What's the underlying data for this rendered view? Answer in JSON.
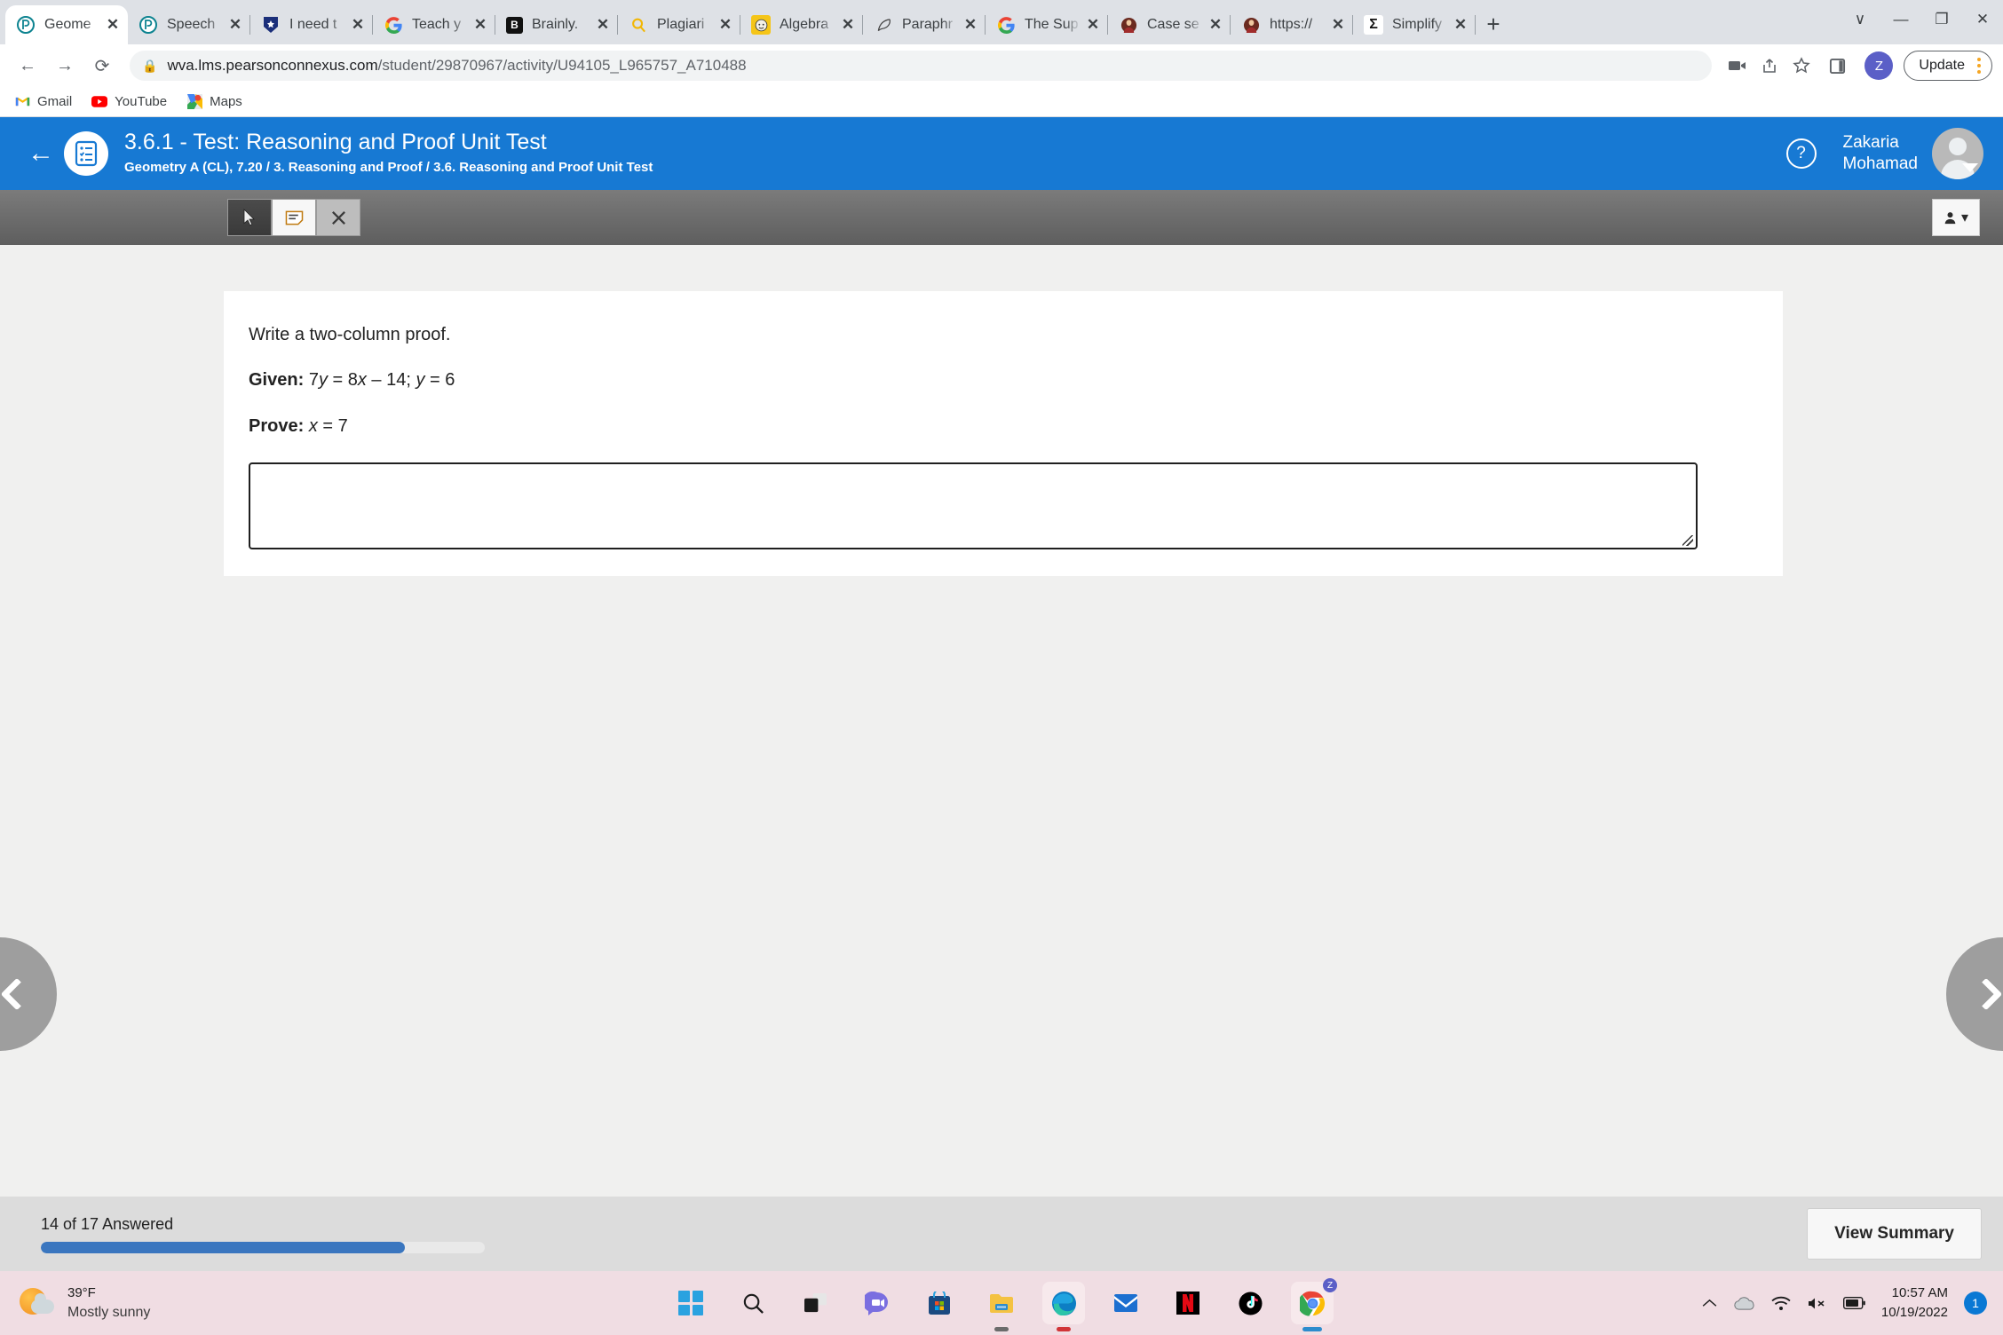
{
  "browser": {
    "tabs": [
      {
        "title": "Geome",
        "icon": "pearson-icon",
        "active": true
      },
      {
        "title": "Speech",
        "icon": "pearson-icon",
        "active": false
      },
      {
        "title": "I need t",
        "icon": "shield-star-icon",
        "active": false
      },
      {
        "title": "Teach y",
        "icon": "google-icon",
        "active": false
      },
      {
        "title": "Brainly.",
        "icon": "brainly-icon",
        "active": false
      },
      {
        "title": "Plagiari",
        "icon": "magnifier-icon",
        "active": false
      },
      {
        "title": "Algebra",
        "icon": "face-icon",
        "active": false
      },
      {
        "title": "Paraphr",
        "icon": "quill-icon",
        "active": false
      },
      {
        "title": "The Sup",
        "icon": "google-icon",
        "active": false
      },
      {
        "title": "Case se",
        "icon": "figure-icon",
        "active": false
      },
      {
        "title": "https://",
        "icon": "figure-icon",
        "active": false
      },
      {
        "title": "Simplify",
        "icon": "sigma-icon",
        "active": false
      }
    ],
    "new_tab_label": "+",
    "close_label": "✕",
    "window_controls": {
      "minimize": "—",
      "restore": "❐",
      "close": "✕",
      "expand": "∨"
    },
    "nav": {
      "back": "←",
      "forward": "→",
      "reload": "⟳"
    },
    "url_prefix": "wva.lms.pearsonconnexus.com",
    "url_suffix": "/student/29870967/activity/U94105_L965757_A710488",
    "lock_icon": "lock-icon",
    "omnibox_actions": [
      "video-camera-icon",
      "share-icon",
      "star-icon"
    ],
    "side_panel_icon": "side-panel-icon",
    "profile_initial": "Z",
    "update_label": "Update",
    "bookmarks": [
      {
        "label": "Gmail",
        "icon": "gmail-icon"
      },
      {
        "label": "YouTube",
        "icon": "youtube-icon"
      },
      {
        "label": "Maps",
        "icon": "maps-icon"
      }
    ]
  },
  "lms_header": {
    "back_label": "←",
    "badge_icon": "test-checklist-icon",
    "title": "3.6.1 - Test: Reasoning and Proof Unit Test",
    "breadcrumb": "Geometry A (CL), 7.20 / 3. Reasoning and Proof / 3.6. Reasoning and Proof Unit Test",
    "help_icon": "question-mark-icon",
    "user_first": "Zakaria",
    "user_last": "Mohamad",
    "avatar_icon": "user-avatar-icon",
    "accent_color": "#1779d3"
  },
  "toolbar": {
    "tools": [
      {
        "name": "pointer-tool",
        "glyph": "➤",
        "state": "dark"
      },
      {
        "name": "sticky-note-tool",
        "glyph": "☰",
        "state": "light"
      },
      {
        "name": "erase-tool",
        "glyph": "✕",
        "state": "grey"
      }
    ],
    "person_menu_icon": "person-icon",
    "person_menu_caret": "▾"
  },
  "question": {
    "instruction": "Write a two-column proof.",
    "given_label": "Given:",
    "given_body_1": "7",
    "given_var_1": "y",
    "given_body_2": " = 8",
    "given_var_2": "x",
    "given_body_3": " – 14; ",
    "given_var_3": "y",
    "given_body_4": " = 6",
    "prove_label": "Prove:",
    "prove_var": "x",
    "prove_body": " = 7",
    "answer_value": "",
    "answer_placeholder": ""
  },
  "navigation": {
    "prev_label": "Previous question",
    "next_label": "Next question"
  },
  "status": {
    "progress_text": "14 of 17 Answered",
    "answered": 14,
    "total": 17,
    "progress_percent": 82,
    "progress_color": "#3a76bf",
    "summary_button": "View Summary"
  },
  "taskbar": {
    "weather_temp": "39°F",
    "weather_condition": "Mostly sunny",
    "weather_icon": "sun-cloud-icon",
    "apps": [
      {
        "name": "start-button",
        "icon": "windows-logo-icon"
      },
      {
        "name": "search-button",
        "icon": "search-icon"
      },
      {
        "name": "task-view-button",
        "icon": "task-view-icon"
      },
      {
        "name": "chat-button",
        "icon": "chat-video-icon"
      },
      {
        "name": "microsoft-store-button",
        "icon": "store-icon"
      },
      {
        "name": "file-explorer-button",
        "icon": "folder-icon"
      },
      {
        "name": "edge-button",
        "icon": "edge-icon"
      },
      {
        "name": "mail-button",
        "icon": "mail-icon"
      },
      {
        "name": "netflix-button",
        "icon": "netflix-icon"
      },
      {
        "name": "tiktok-button",
        "icon": "tiktok-icon"
      },
      {
        "name": "chrome-button",
        "icon": "chrome-icon"
      }
    ],
    "tray": {
      "overflow_icon": "chevron-up-icon",
      "onedrive_icon": "onedrive-icon",
      "wifi_icon": "wifi-icon",
      "volume_icon": "volume-muted-icon",
      "battery_icon": "battery-icon",
      "time": "10:57 AM",
      "date": "10/19/2022",
      "notification_count": "1"
    }
  }
}
